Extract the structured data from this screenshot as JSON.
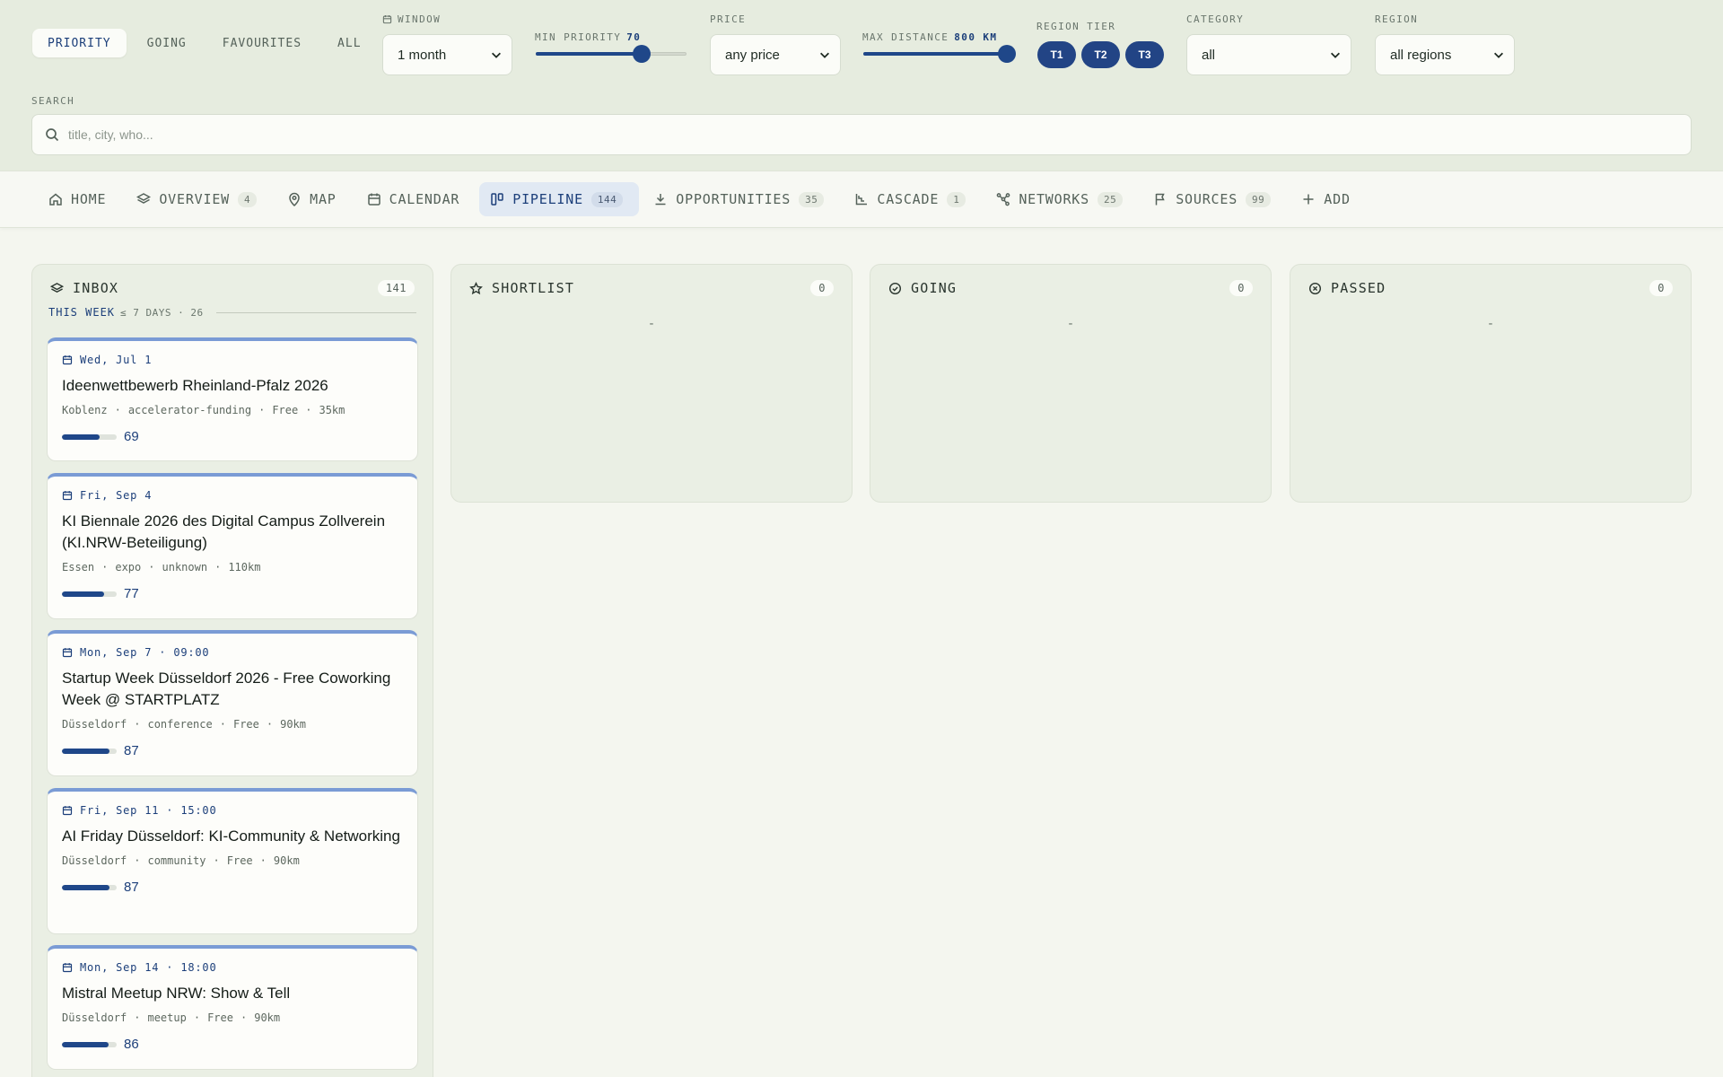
{
  "filters": {
    "view_toggle": [
      "PRIORITY",
      "GOING",
      "FAVOURITES",
      "ALL"
    ],
    "view_active": "PRIORITY",
    "window": {
      "label": "WINDOW",
      "value": "1 month",
      "icon": "calendar-icon"
    },
    "min_priority": {
      "label": "MIN PRIORITY",
      "value": "70",
      "fraction": 0.7
    },
    "price": {
      "label": "PRICE",
      "value": "any price"
    },
    "max_distance": {
      "label": "MAX DISTANCE",
      "value": "800 KM",
      "fraction": 1.0
    },
    "region_tier": {
      "label": "REGION TIER",
      "tiers": [
        "T1",
        "T2",
        "T3"
      ]
    },
    "category": {
      "label": "CATEGORY",
      "value": "all"
    },
    "region": {
      "label": "REGION",
      "value": "all regions"
    },
    "search": {
      "label": "SEARCH",
      "placeholder": "title, city, who..."
    }
  },
  "tabs": [
    {
      "label": "HOME",
      "badge": "",
      "icon": "home-icon"
    },
    {
      "label": "OVERVIEW",
      "badge": "4",
      "icon": "layers-icon"
    },
    {
      "label": "MAP",
      "badge": "",
      "icon": "map-pin-icon"
    },
    {
      "label": "CALENDAR",
      "badge": "",
      "icon": "calendar-icon"
    },
    {
      "label": "PIPELINE",
      "badge": "144",
      "icon": "kanban-icon",
      "active": true
    },
    {
      "label": "OPPORTUNITIES",
      "badge": "35",
      "icon": "download-icon"
    },
    {
      "label": "CASCADE",
      "badge": "1",
      "icon": "cascade-icon"
    },
    {
      "label": "NETWORKS",
      "badge": "25",
      "icon": "network-icon"
    },
    {
      "label": "SOURCES",
      "badge": "99",
      "icon": "flag-icon"
    },
    {
      "label": "ADD",
      "badge": "",
      "icon": "plus-icon"
    }
  ],
  "board": {
    "inbox": {
      "title": "INBOX",
      "count": "141",
      "icon": "layers-icon",
      "week_label": "THIS WEEK",
      "week_meta": "≤ 7 DAYS · 26",
      "cards": [
        {
          "date": "Wed, Jul 1",
          "title": "Ideenwettbewerb Rheinland-Pfalz 2026",
          "city": "Koblenz",
          "category": "accelerator-funding",
          "price": "Free",
          "distance": "35km",
          "score": "69",
          "score_fraction": 0.69
        },
        {
          "date": "Fri, Sep 4",
          "title": "KI Biennale 2026 des Digital Campus Zollverein (KI.NRW-Beteiligung)",
          "city": "Essen",
          "category": "expo",
          "price": "unknown",
          "distance": "110km",
          "score": "77",
          "score_fraction": 0.77
        },
        {
          "date": "Mon, Sep 7 · 09:00",
          "title": "Startup Week Düsseldorf 2026 - Free Coworking Week @ STARTPLATZ",
          "city": "Düsseldorf",
          "category": "conference",
          "price": "Free",
          "distance": "90km",
          "score": "87",
          "score_fraction": 0.87
        },
        {
          "date": "Fri, Sep 11 · 15:00",
          "title": "AI Friday Düsseldorf: KI-Community & Networking",
          "city": "Düsseldorf",
          "category": "community",
          "price": "Free",
          "distance": "90km",
          "score": "87",
          "score_fraction": 0.87
        },
        {
          "date": "Mon, Sep 14 · 18:00",
          "title": "Mistral Meetup NRW: Show & Tell",
          "city": "Düsseldorf",
          "category": "meetup",
          "price": "Free",
          "distance": "90km",
          "score": "86",
          "score_fraction": 0.86
        }
      ]
    },
    "shortlist": {
      "title": "SHORTLIST",
      "count": "0",
      "empty": "-",
      "icon": "star-icon"
    },
    "going": {
      "title": "GOING",
      "count": "0",
      "empty": "-",
      "icon": "check-circle-icon"
    },
    "passed": {
      "title": "PASSED",
      "count": "0",
      "empty": "-",
      "icon": "x-circle-icon"
    }
  },
  "colors": {
    "accent": "#1f4789",
    "card_top": "#7a9bd5",
    "active_tab_bg": "#e1e9f3"
  }
}
